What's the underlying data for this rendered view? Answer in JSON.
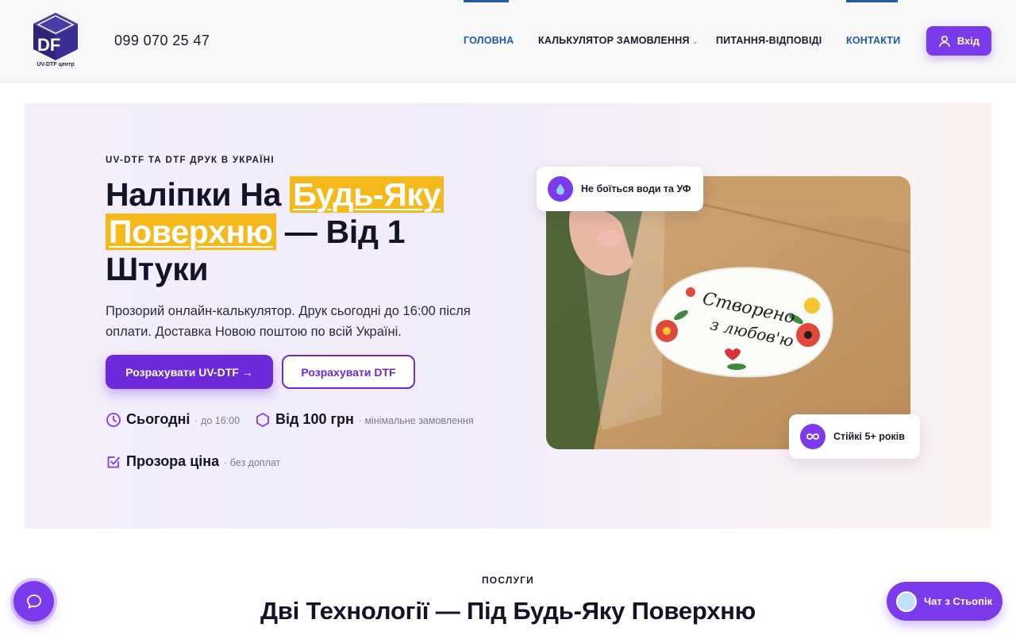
{
  "header": {
    "logo_text": "DF",
    "logo_caption": "UV-DTF центр",
    "phone": "099 070 25 47",
    "nav": [
      {
        "label": "ГОЛОВНА",
        "active": true
      },
      {
        "label": "КАЛЬКУЛЯТОР ЗАМОВЛЕННЯ",
        "active": false,
        "has_dropdown": true
      },
      {
        "label": "ПИТАННЯ-ВІДПОВІДІ",
        "active": false
      },
      {
        "label": "КОНТАКТИ",
        "active": true
      }
    ],
    "login_label": "Вхід",
    "login_icon": "user-icon"
  },
  "hero": {
    "eyebrow": "UV-DTF ТА DTF ДРУК В УКРАЇНІ",
    "headline": {
      "part1": "Наліпки На ",
      "highlight1": "Будь-Яку",
      "highlight2": "Поверхню",
      "part2": " — Від 1 Штуки"
    },
    "description": "Прозорий онлайн-калькулятор. Друк сьогодні до 16:00 після оплати. Доставка Новою поштою по всій Україні.",
    "primary_button": "Розрахувати UV-DTF →",
    "secondary_button": "Розрахувати DTF",
    "features": [
      {
        "icon": "clock-icon",
        "title": "Сьогодні",
        "sub": "· до 16:00"
      },
      {
        "icon": "hexagon-icon",
        "title": "Від 100 грн",
        "sub": "· мінімальне замовлення"
      },
      {
        "icon": "checkbox-icon",
        "title": "Прозора ціна",
        "sub": "· без доплат"
      }
    ],
    "photo": {
      "sticker_line1": "Створено",
      "sticker_line2": "з любов'ю"
    },
    "badge_top": {
      "icon": "water-drop-icon",
      "text": "Не боїться води та УФ"
    },
    "badge_bottom": {
      "icon": "infinity-icon",
      "text": "Стійкі 5+ років"
    }
  },
  "services": {
    "label": "ПОСЛУГИ",
    "title": "Дві Технології — Під Будь-Яку Поверхню"
  },
  "floating": {
    "chat_icon": "chat-bubble-icon",
    "assistant_label": "Чат з Стьопік"
  },
  "colors": {
    "accent": "#7c3aed",
    "nav_active": "#1d5aa8",
    "highlight": "#f5b91b"
  }
}
